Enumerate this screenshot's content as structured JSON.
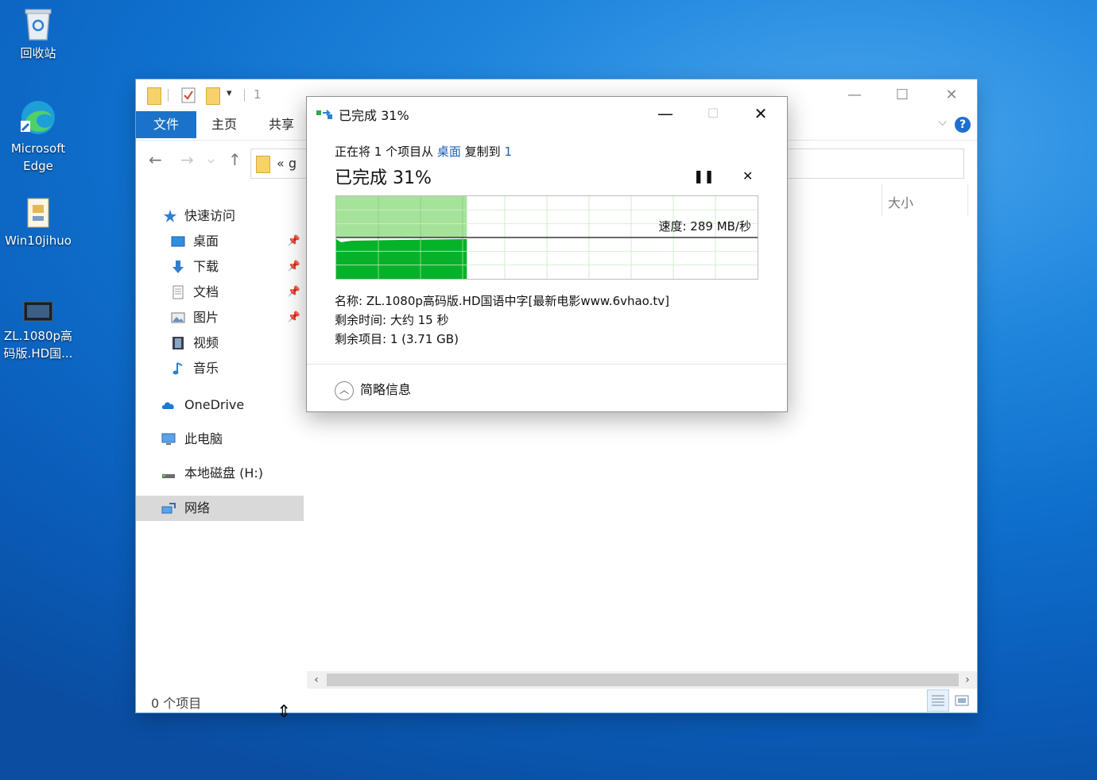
{
  "desktop": {
    "icons": [
      {
        "label": "回收站"
      },
      {
        "label": "Microsoft Edge"
      },
      {
        "label": "Win10jihuo"
      },
      {
        "label": "ZL.1080p高码版.HD国..."
      }
    ]
  },
  "explorer": {
    "qa_number": "1",
    "ribbon_tabs": [
      "文件",
      "主页",
      "共享"
    ],
    "address_crumb": "« g",
    "column_size": "大小",
    "sidebar": [
      {
        "label": "快速访问"
      },
      {
        "label": "桌面"
      },
      {
        "label": "下载"
      },
      {
        "label": "文档"
      },
      {
        "label": "图片"
      },
      {
        "label": "视频"
      },
      {
        "label": "音乐"
      },
      {
        "label": "OneDrive"
      },
      {
        "label": "此电脑"
      },
      {
        "label": "本地磁盘 (H:)"
      },
      {
        "label": "网络"
      }
    ],
    "status_text": "0 个项目"
  },
  "dialog": {
    "title": "已完成 31%",
    "line_prefix": "正在将 1 个项目从",
    "source": "桌面",
    "line_mid": "复制到",
    "dest": "1",
    "progress_label": "已完成 31%",
    "progress_fraction": 0.31,
    "speed": "速度: 289 MB/秒",
    "name": "名称: ZL.1080p高码版.HD国语中字[最新电影www.6vhao.tv]",
    "time_left": "剩余时间: 大约 15 秒",
    "items_left": "剩余项目: 1 (3.71 GB)",
    "less_details": "简略信息"
  },
  "colors": {
    "accent": "#1a73c9",
    "progress_light": "#a6e39a",
    "progress_dark": "#06b22a",
    "link": "#1a5fb4"
  }
}
